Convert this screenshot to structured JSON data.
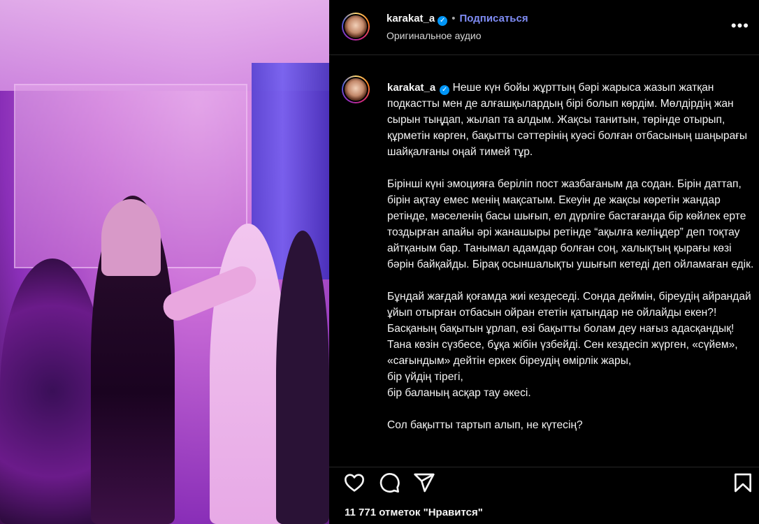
{
  "media": {
    "description_icon": "video-still"
  },
  "header": {
    "username": "karakat_a",
    "verified_icon": "verified-badge-icon",
    "separator": "•",
    "follow_label": "Подписаться",
    "audio_label": "Оригинальное аудио",
    "more_icon": "more-options-icon"
  },
  "caption": {
    "username": "karakat_a",
    "text": "Неше күн бойы жұрттың бәрі жарыса жазып жатқан подкастты мен де алғашқылардың бірі болып көрдім. Мөлдірдің жан сырын тыңдап, жылап та алдым. Жақсы танитын, төрінде отырып, құрметін көрген, бақытты сәттерінің куәсі болған отбасының шаңырағы шайқалғаны оңай тимей тұр.\n\nБірінші күні эмоцияға беріліп пост жазбағаным да содан. Бірін даттап, бірін ақтау емес менің мақсатым. Екеуін де жақсы көретін жандар ретінде, мәселенің басы шығып, ел дүрліге бастағанда бір көйлек ерте тоздырған апайы әрі жанашыры ретінде “ақылға келіңдер” деп тоқтау айтқаным бар. Танымал адамдар болған соң, халықтың қырағы көзі бәрін байқайды. Бірақ осыншалықты ушығып кетеді деп ойламаған едік.\n\nБұндай жағдай қоғамда жиі кездеседі. Сонда деймін, біреудің айрандай ұйып отырған отбасын ойран ететін қатындар не ойлайды екен?! Басқаның бақытын ұрлап, өзі бақытты болам деу нағыз адасқандық!\nТана көзін сүзбесе, бұқа жібін үзбейді. Сен кездесіп жүрген, «сүйем», «сағындым» дейтін еркек біреудің өмірлік жары,\nбір үйдің тірегі,\nбір баланың асқар тау әкесі.\n\nСол бақытты тартып алып, не күтесің?"
  },
  "actions": {
    "like_icon": "heart-icon",
    "comment_icon": "comment-icon",
    "share_icon": "share-icon",
    "save_icon": "bookmark-icon"
  },
  "likes_label": "11 771 отметок \"Нравится\""
}
